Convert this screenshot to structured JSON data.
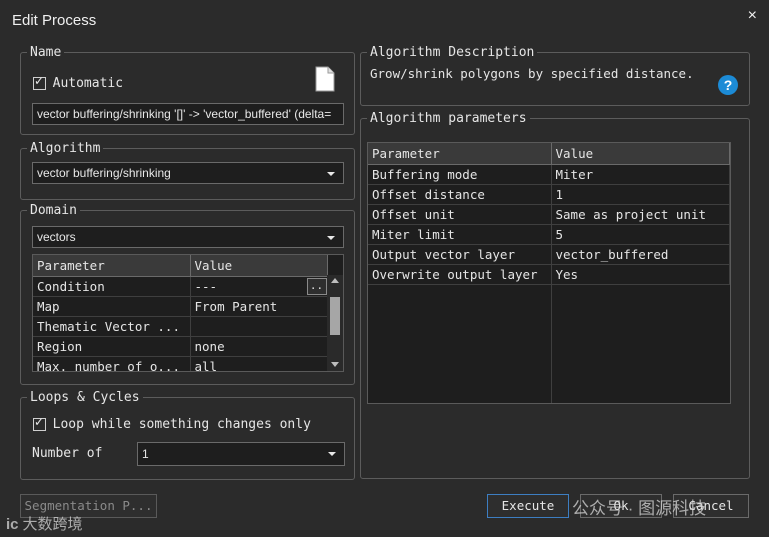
{
  "window": {
    "title": "Edit Process",
    "close_glyph": "×"
  },
  "name": {
    "legend": "Name",
    "automatic_label": "Automatic",
    "process_text": "vector buffering/shrinking '[]' -> 'vector_buffered' (delta="
  },
  "algorithm": {
    "legend": "Algorithm",
    "selected": "vector buffering/shrinking"
  },
  "domain": {
    "legend": "Domain",
    "selected": "vectors",
    "headers": [
      "Parameter",
      "Value"
    ],
    "rows": [
      [
        "Condition",
        "---"
      ],
      [
        "Map",
        "From Parent"
      ],
      [
        "Thematic Vector ...",
        ""
      ],
      [
        "Region",
        "none"
      ],
      [
        "Max. number of o...",
        "all"
      ]
    ],
    "ellipsis_button": ".."
  },
  "loops": {
    "legend": "Loops & Cycles",
    "loop_label": "Loop while something changes only",
    "number_label": "Number of",
    "number_value": "1"
  },
  "description": {
    "legend": "Algorithm Description",
    "text": "Grow/shrink polygons by specified distance."
  },
  "parameters": {
    "legend": "Algorithm parameters",
    "headers": [
      "Parameter",
      "Value"
    ],
    "rows": [
      [
        "Buffering mode",
        "Miter"
      ],
      [
        "Offset distance",
        "1"
      ],
      [
        "Offset unit",
        "Same as project unit"
      ],
      [
        "Miter limit",
        "5"
      ],
      [
        "Output vector layer",
        "vector_buffered"
      ],
      [
        "Overwrite output layer",
        "Yes"
      ]
    ]
  },
  "buttons": {
    "segmentation": "Segmentation P...",
    "execute": "Execute",
    "ok": "Ok",
    "cancel": "Cancel"
  },
  "watermark": {
    "left": "大数跨境",
    "right": "公众号 · 图源科技"
  },
  "colors": {
    "background": "#2b2b2b",
    "accent": "#1c8bd6",
    "default_button_border": "#3d7ec2"
  }
}
